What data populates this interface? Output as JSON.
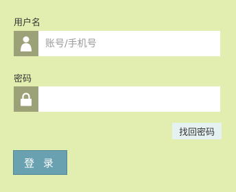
{
  "form": {
    "username_label": "用户名",
    "username_placeholder": "账号/手机号",
    "username_value": "",
    "password_label": "密码",
    "password_value": "",
    "forgot_password_label": "找回密码",
    "login_label": "登 录"
  },
  "icons": {
    "username": "user-icon",
    "password": "lock-icon"
  },
  "colors": {
    "page_background": "#e2eeb0",
    "icon_background": "#9da178",
    "forgot_background": "#e6f2f2",
    "login_background": "#6aa1b1"
  }
}
